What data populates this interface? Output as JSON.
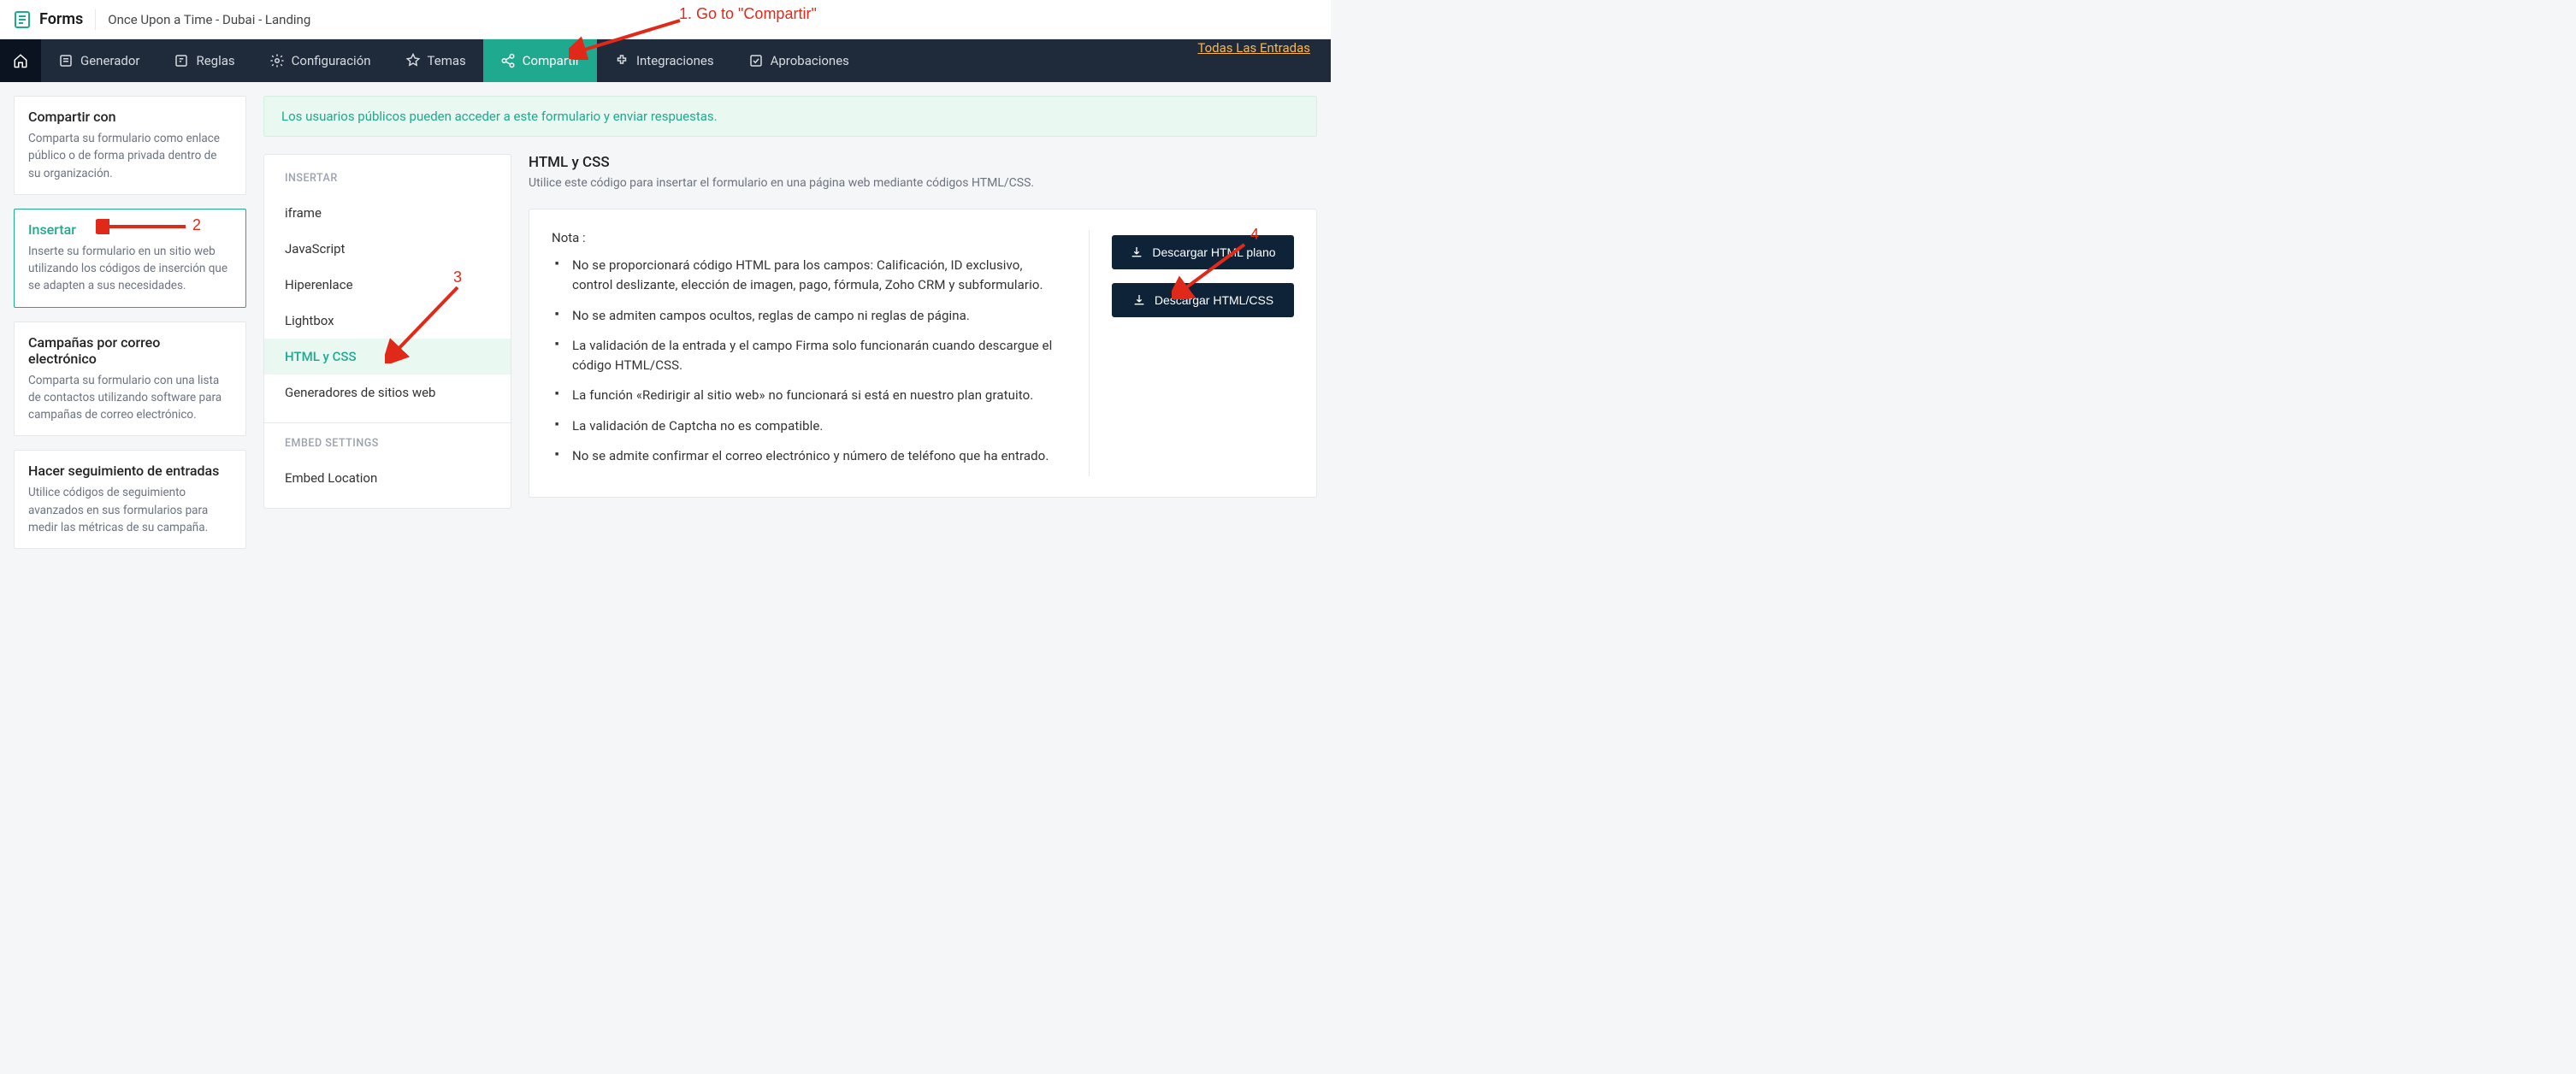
{
  "brand": {
    "name": "Forms"
  },
  "header": {
    "form_name": "Once Upon a Time - Dubai - Landing"
  },
  "nav": {
    "items": [
      {
        "label": "Generador"
      },
      {
        "label": "Reglas"
      },
      {
        "label": "Configuración"
      },
      {
        "label": "Temas"
      },
      {
        "label": "Compartir"
      },
      {
        "label": "Integraciones"
      },
      {
        "label": "Aprobaciones"
      }
    ],
    "all_entries": "Todas Las Entradas"
  },
  "sidebar": {
    "cards": [
      {
        "title": "Compartir con",
        "desc": "Comparta su formulario como enlace público o de forma privada dentro de su organización."
      },
      {
        "title": "Insertar",
        "desc": "Inserte su formulario en un sitio web utilizando los códigos de inserción que se adapten a sus necesidades."
      },
      {
        "title": "Campañas por correo electrónico",
        "desc": "Comparta su formulario con una lista de contactos utilizando software para campañas de correo electrónico."
      },
      {
        "title": "Hacer seguimiento de entradas",
        "desc": "Utilice códigos de seguimiento avanzados en sus formularios para medir las métricas de su campaña."
      }
    ]
  },
  "banner": {
    "text": "Los usuarios públicos pueden acceder a este formulario y enviar respuestas."
  },
  "insert": {
    "heading": "INSERTAR",
    "items": [
      {
        "label": "iframe"
      },
      {
        "label": "JavaScript"
      },
      {
        "label": "Hiperenlace"
      },
      {
        "label": "Lightbox"
      },
      {
        "label": "HTML y CSS"
      },
      {
        "label": "Generadores de sitios web"
      }
    ],
    "embed_heading": "EMBED SETTINGS",
    "embed_items": [
      {
        "label": "Embed Location"
      }
    ]
  },
  "main": {
    "title": "HTML y CSS",
    "desc": "Utilice este código para insertar el formulario en una página web mediante códigos HTML/CSS.",
    "note_title": "Nota :",
    "notes": [
      "No se proporcionará código HTML para los campos: Calificación, ID exclusivo, control deslizante, elección de imagen, pago, fórmula, Zoho CRM y subformulario.",
      "No se admiten campos ocultos, reglas de campo ni reglas de página.",
      "La validación de la entrada y el campo Firma solo funcionarán cuando descargue el código HTML/CSS.",
      "La función «Redirigir al sitio web» no funcionará si está en nuestro plan gratuito.",
      "La validación de Captcha no es compatible.",
      "No se admite confirmar el correo electrónico y número de teléfono que ha entrado."
    ],
    "buttons": {
      "download_plain": "Descargar HTML plano",
      "download_css": "Descargar HTML/CSS"
    }
  },
  "annotations": {
    "a1": "1. Go to \"Compartir\"",
    "a2": "2",
    "a3": "3",
    "a4": "4"
  }
}
